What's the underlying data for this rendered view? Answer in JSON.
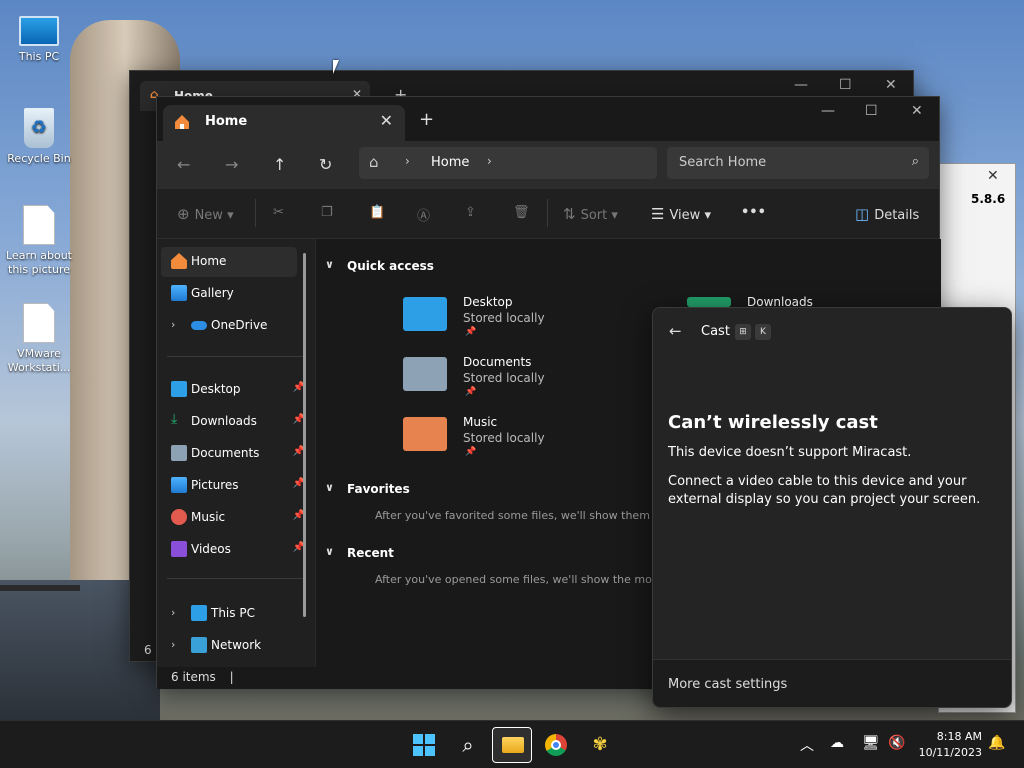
{
  "desktop": {
    "icons": [
      {
        "label": "This PC"
      },
      {
        "label": "Recycle Bin"
      },
      {
        "label": "Learn about this picture"
      },
      {
        "label": "VMware Workstati..."
      }
    ]
  },
  "back_window": {
    "tab_title": "Home",
    "status_partial": "6 i"
  },
  "explorer": {
    "tab_title": "Home",
    "breadcrumb": [
      "Home"
    ],
    "search_placeholder": "Search Home",
    "toolbar": {
      "new": "New",
      "sort": "Sort",
      "view": "View",
      "details": "Details"
    },
    "sidebar": {
      "items": [
        {
          "label": "Home",
          "icon": "home-icon",
          "selected": true
        },
        {
          "label": "Gallery",
          "icon": "gallery-icon"
        },
        {
          "label": "OneDrive",
          "icon": "cloud-icon",
          "expandable": true
        },
        {
          "label": "Desktop",
          "icon": "desktop-icon",
          "pinned": true
        },
        {
          "label": "Downloads",
          "icon": "download-icon",
          "pinned": true
        },
        {
          "label": "Documents",
          "icon": "documents-icon",
          "pinned": true
        },
        {
          "label": "Pictures",
          "icon": "pictures-icon",
          "pinned": true
        },
        {
          "label": "Music",
          "icon": "music-icon",
          "pinned": true
        },
        {
          "label": "Videos",
          "icon": "videos-icon",
          "pinned": true
        },
        {
          "label": "This PC",
          "icon": "pc-icon",
          "expandable": true
        },
        {
          "label": "Network",
          "icon": "network-icon",
          "expandable": true
        }
      ]
    },
    "quick_access": {
      "heading": "Quick access",
      "items": [
        {
          "name": "Desktop",
          "status": "Stored locally",
          "color": "#2d9fe6"
        },
        {
          "name": "Documents",
          "status": "Stored locally",
          "color": "#8ea2b6"
        },
        {
          "name": "Music",
          "status": "Stored locally",
          "color": "#e7834f"
        },
        {
          "name": "Downloads",
          "status": "",
          "color": "#22a06b"
        }
      ]
    },
    "favorites": {
      "heading": "Favorites",
      "hint": "After you've favorited some files, we'll show them he"
    },
    "recent": {
      "heading": "Recent",
      "hint": "After you've opened some files, we'll show the most r"
    },
    "status": "6 items"
  },
  "bg_app": {
    "version": "5.8.6"
  },
  "cast": {
    "title": "Cast",
    "key1": "⊞",
    "key2": "K",
    "heading": "Can’t wirelessly cast",
    "message1": "This device doesn’t support Miracast.",
    "message2": "Connect a video cable to this device and your external display so you can project your screen.",
    "footer": "More cast settings"
  },
  "taskbar": {
    "time": "8:18 AM",
    "date": "10/11/2023"
  }
}
